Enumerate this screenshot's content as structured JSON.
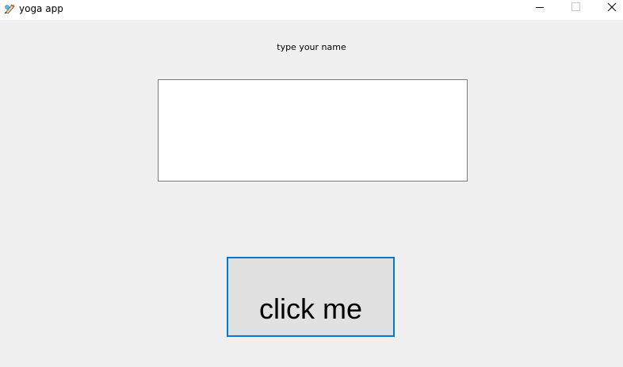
{
  "window": {
    "title": "yoga app",
    "icon": "feather-pen-icon",
    "controls": [
      "minimize",
      "maximize",
      "close"
    ]
  },
  "form": {
    "label": "type your name",
    "name_input_value": "",
    "name_input_placeholder": ""
  },
  "action": {
    "button_label": "click me"
  },
  "colors": {
    "background": "#f0f0f0",
    "titlebar": "#ffffff",
    "button_face": "#e1e1e1",
    "focus_border": "#0078d7",
    "input_border": "#7a7a7a"
  }
}
